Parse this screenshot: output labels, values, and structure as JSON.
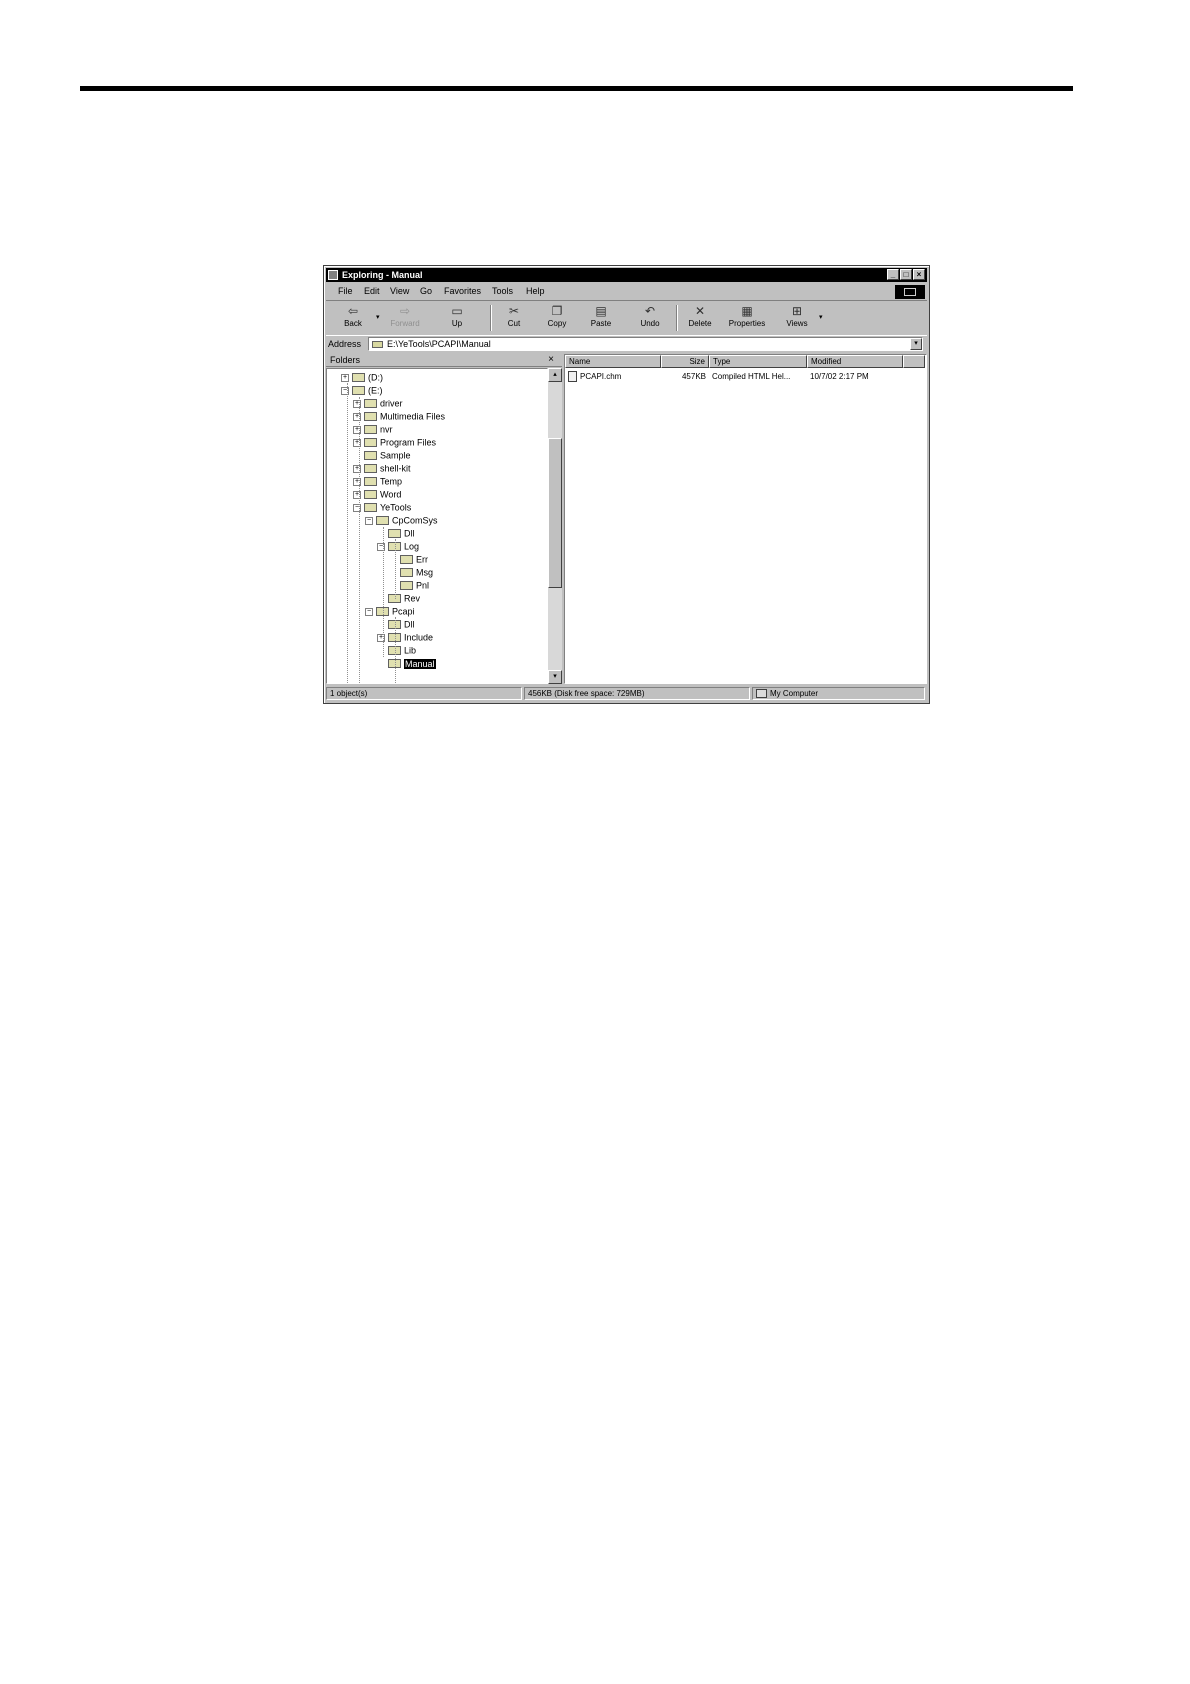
{
  "window": {
    "title": "Exploring - Manual",
    "controls": {
      "minimize": "_",
      "maximize": "□",
      "close": "×"
    }
  },
  "menu": [
    "File",
    "Edit",
    "View",
    "Go",
    "Favorites",
    "Tools",
    "Help"
  ],
  "toolbar": {
    "back": "Back",
    "forward": "Forward",
    "up": "Up",
    "cut": "Cut",
    "copy": "Copy",
    "paste": "Paste",
    "undo": "Undo",
    "delete": "Delete",
    "properties": "Properties",
    "views": "Views",
    "drop_arrow": "▾"
  },
  "address": {
    "label": "Address",
    "value": "E:\\YeTools\\PCAPI\\Manual",
    "drop_arrow": "▾"
  },
  "folders": {
    "title": "Folders",
    "close": "×",
    "scroll_up": "▴",
    "scroll_down": "▾",
    "tree": [
      {
        "label": "(D:)",
        "expander": "+"
      },
      {
        "label": "(E:)",
        "expander": "−"
      },
      {
        "label": "driver",
        "expander": "+"
      },
      {
        "label": "Multimedia Files",
        "expander": "+"
      },
      {
        "label": "nvr",
        "expander": "+"
      },
      {
        "label": "Program Files",
        "expander": "+"
      },
      {
        "label": "Sample",
        "expander": ""
      },
      {
        "label": "shell-kit",
        "expander": "+"
      },
      {
        "label": "Temp",
        "expander": "+"
      },
      {
        "label": "Word",
        "expander": "+"
      },
      {
        "label": "YeTools",
        "expander": "−"
      },
      {
        "label": "CpComSys",
        "expander": "−"
      },
      {
        "label": "Dll",
        "expander": ""
      },
      {
        "label": "Log",
        "expander": "−"
      },
      {
        "label": "Err",
        "expander": ""
      },
      {
        "label": "Msg",
        "expander": ""
      },
      {
        "label": "Pnl",
        "expander": ""
      },
      {
        "label": "Rev",
        "expander": ""
      },
      {
        "label": "Pcapi",
        "expander": "−"
      },
      {
        "label": "Dll",
        "expander": ""
      },
      {
        "label": "Include",
        "expander": "+"
      },
      {
        "label": "Lib",
        "expander": ""
      },
      {
        "label": "Manual",
        "expander": ""
      }
    ]
  },
  "list": {
    "columns": [
      "Name",
      "Size",
      "Type",
      "Modified"
    ],
    "rows": [
      {
        "name": "PCAPI.chm",
        "size": "457KB",
        "type": "Compiled HTML Hel...",
        "modified": "10/7/02 2:17 PM"
      }
    ]
  },
  "status": {
    "objects": "1 object(s)",
    "size": "456KB (Disk free space: 729MB)",
    "location": "My Computer"
  }
}
